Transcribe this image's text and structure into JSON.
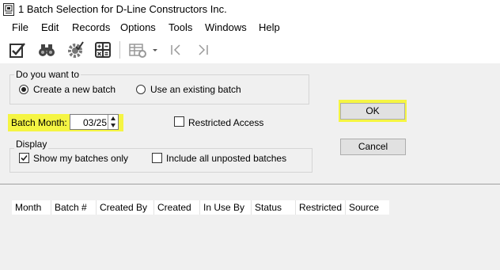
{
  "window": {
    "title": "1 Batch Selection for D-Line Constructors Inc."
  },
  "menu": {
    "items": [
      "File",
      "Edit",
      "Records",
      "Options",
      "Tools",
      "Windows",
      "Help"
    ]
  },
  "toolbar": {
    "icons": [
      "checklist-icon",
      "binoculars-icon",
      "gear-check-icon",
      "calculator-icon",
      "grid-settings-icon",
      "dropdown-arrow-icon",
      "first-record-icon",
      "last-record-icon"
    ]
  },
  "batch_choice": {
    "group_label": "Do you want to",
    "create_label": "Create a new batch",
    "existing_label": "Use an existing batch",
    "selected": "create"
  },
  "batch_month": {
    "label": "Batch Month:",
    "value": "03/25"
  },
  "restricted": {
    "label": "Restricted Access",
    "checked": false
  },
  "display": {
    "group_label": "Display",
    "my_batches_label": "Show my batches only",
    "my_batches_checked": true,
    "unposted_label": "Include all unposted batches",
    "unposted_checked": false
  },
  "buttons": {
    "ok": "OK",
    "cancel": "Cancel"
  },
  "grid": {
    "columns": [
      "Month",
      "Batch #",
      "Created By",
      "Created",
      "In Use By",
      "Status",
      "Restricted",
      "Source"
    ]
  },
  "colors": {
    "highlight": "#f5f543",
    "panel": "#f0f0f0"
  }
}
